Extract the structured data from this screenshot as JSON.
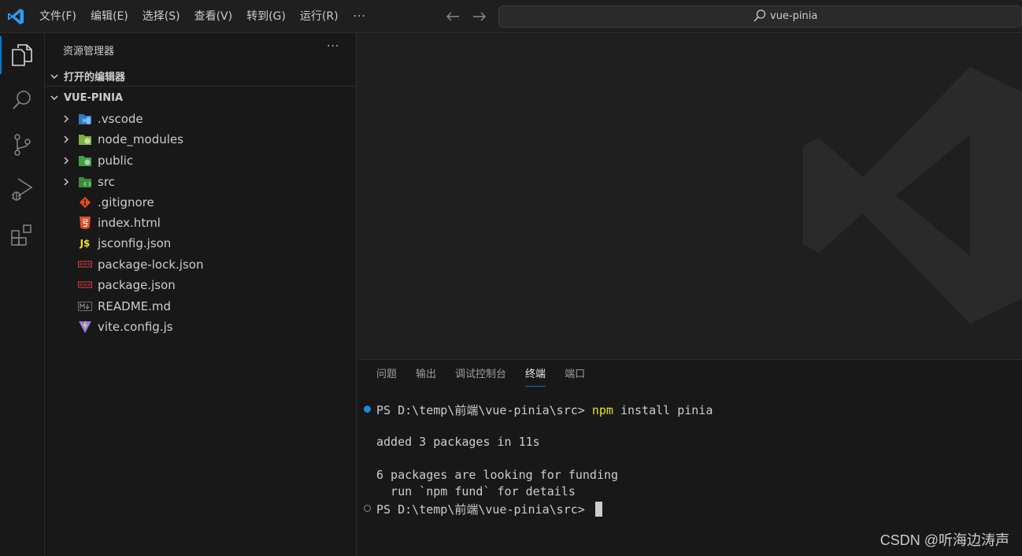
{
  "titlebar": {
    "menu": [
      "文件(F)",
      "编辑(E)",
      "选择(S)",
      "查看(V)",
      "转到(G)",
      "运行(R)"
    ],
    "more": "···",
    "search_text": "vue-pinia"
  },
  "activity": [
    "explorer-icon",
    "search-icon",
    "source-control-icon",
    "run-debug-icon",
    "extensions-icon"
  ],
  "sidebar": {
    "title": "资源管理器",
    "more": "···",
    "open_editors": "打开的编辑器",
    "root": "VUE-PINIA",
    "items": [
      {
        "name": ".vscode",
        "type": "folder",
        "icon": "vscode-folder-icon"
      },
      {
        "name": "node_modules",
        "type": "folder",
        "icon": "node-folder-icon"
      },
      {
        "name": "public",
        "type": "folder",
        "icon": "public-folder-icon"
      },
      {
        "name": "src",
        "type": "folder",
        "icon": "src-folder-icon"
      },
      {
        "name": ".gitignore",
        "type": "file",
        "icon": "git-icon"
      },
      {
        "name": "index.html",
        "type": "file",
        "icon": "html5-icon"
      },
      {
        "name": "jsconfig.json",
        "type": "file",
        "icon": "js-icon"
      },
      {
        "name": "package-lock.json",
        "type": "file",
        "icon": "npm-icon"
      },
      {
        "name": "package.json",
        "type": "file",
        "icon": "npm-icon"
      },
      {
        "name": "README.md",
        "type": "file",
        "icon": "markdown-icon"
      },
      {
        "name": "vite.config.js",
        "type": "file",
        "icon": "vite-icon"
      }
    ]
  },
  "panel": {
    "tabs": [
      "问题",
      "输出",
      "调试控制台",
      "终端",
      "端口"
    ],
    "active_tab": "终端",
    "terminal": {
      "prompt1": "PS D:\\temp\\前端\\vue-pinia\\src> ",
      "cmd_npm": "npm",
      "cmd_rest": " install pinia",
      "out1": "added 3 packages in 11s",
      "out2": "6 packages are looking for funding",
      "out3": "  run `npm fund` for details",
      "prompt2": "PS D:\\temp\\前端\\vue-pinia\\src> "
    }
  },
  "watermark_text": "CSDN @听海边涛声",
  "colors": {
    "accent": "#0078d4",
    "background": "#1f1f1f",
    "sidebar": "#181818",
    "npm_command": "#e5e510"
  }
}
